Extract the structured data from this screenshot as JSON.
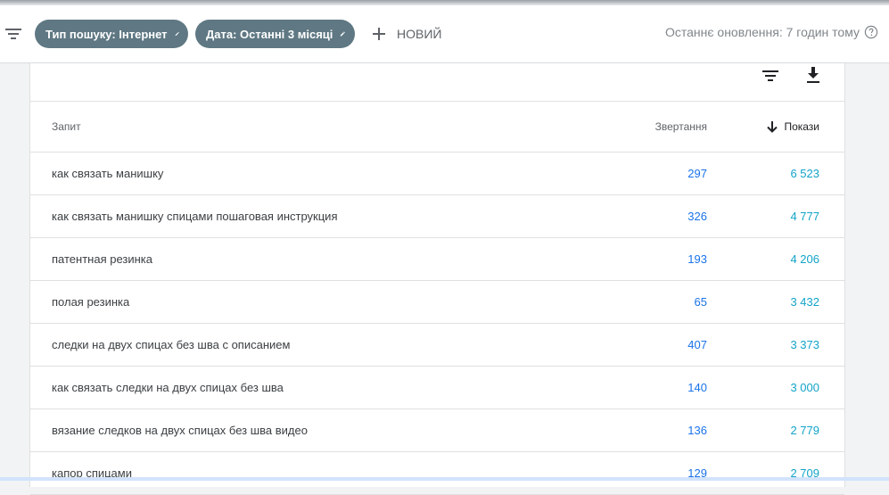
{
  "toolbar": {
    "chips": [
      {
        "label": "Тип пошуку: Інтернет"
      },
      {
        "label": "Дата: Останні 3 місяці"
      }
    ],
    "new_label": "НОВИЙ",
    "last_update": "Останнє оновлення: 7 годин тому"
  },
  "table": {
    "headers": {
      "query": "Запит",
      "clicks": "Звертання",
      "impressions": "Покази"
    },
    "rows": [
      {
        "query": "как связать манишку",
        "clicks": "297",
        "impressions": "6 523"
      },
      {
        "query": "как связать манишку спицами пошаговая инструкция",
        "clicks": "326",
        "impressions": "4 777"
      },
      {
        "query": "патентная резинка",
        "clicks": "193",
        "impressions": "4 206"
      },
      {
        "query": "полая резинка",
        "clicks": "65",
        "impressions": "3 432"
      },
      {
        "query": "следки на двух спицах без шва с описанием",
        "clicks": "407",
        "impressions": "3 373"
      },
      {
        "query": "как связать следки на двух спицах без шва",
        "clicks": "140",
        "impressions": "3 000"
      },
      {
        "query": "вязание следков на двух спицах без шва видео",
        "clicks": "136",
        "impressions": "2 779"
      },
      {
        "query": "капор спицами",
        "clicks": "129",
        "impressions": "2 709"
      }
    ]
  },
  "colors": {
    "chip_bg": "#5f7883",
    "clicks": "#1a73e8",
    "impressions": "#12a4c8"
  },
  "icons": [
    "filter-icon",
    "edit-icon",
    "plus-icon",
    "help-icon",
    "download-icon",
    "arrow-down-icon"
  ]
}
